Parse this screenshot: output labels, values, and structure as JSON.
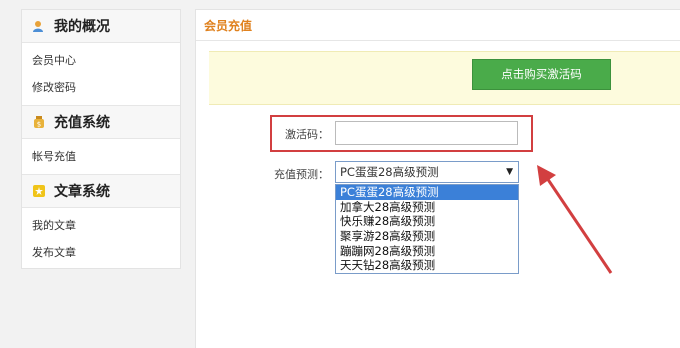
{
  "sidebar": {
    "sections": [
      {
        "title": "我的概况",
        "icon": "user-icon",
        "items": [
          "会员中心",
          "修改密码"
        ]
      },
      {
        "title": "充值系统",
        "icon": "money-bag-icon",
        "items": [
          "帐号充值"
        ]
      },
      {
        "title": "文章系统",
        "icon": "article-icon",
        "items": [
          "我的文章",
          "发布文章"
        ]
      }
    ]
  },
  "main": {
    "title": "会员充值",
    "buy_button": "点击购买激活码",
    "code_label": "激活码：",
    "code_value": "",
    "predict_label": "充值预测：",
    "select_value": "PC蛋蛋28高级预测",
    "options": [
      "PC蛋蛋28高级预测",
      "加拿大28高级预测",
      "快乐赚28高级预测",
      "聚享游28高级预测",
      "蹦蹦网28高级预测",
      "天天钻28高级预测"
    ]
  },
  "colors": {
    "accent": "#e0821f",
    "button_green": "#4aab4a",
    "highlight_red": "#d23f40",
    "option_selected": "#3b80d8"
  }
}
